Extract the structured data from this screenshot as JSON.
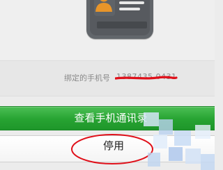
{
  "profile": {
    "card_icon": "id-card-icon",
    "avatar_color": "#e8952a"
  },
  "binding": {
    "label": "绑定的手机号",
    "number_partial": "1387435 0431"
  },
  "actions": {
    "view_contacts_label": "查看手机通讯录",
    "disable_label": "停用"
  },
  "colors": {
    "primary_green": "#27a332",
    "annotation_red": "#e0101a"
  }
}
